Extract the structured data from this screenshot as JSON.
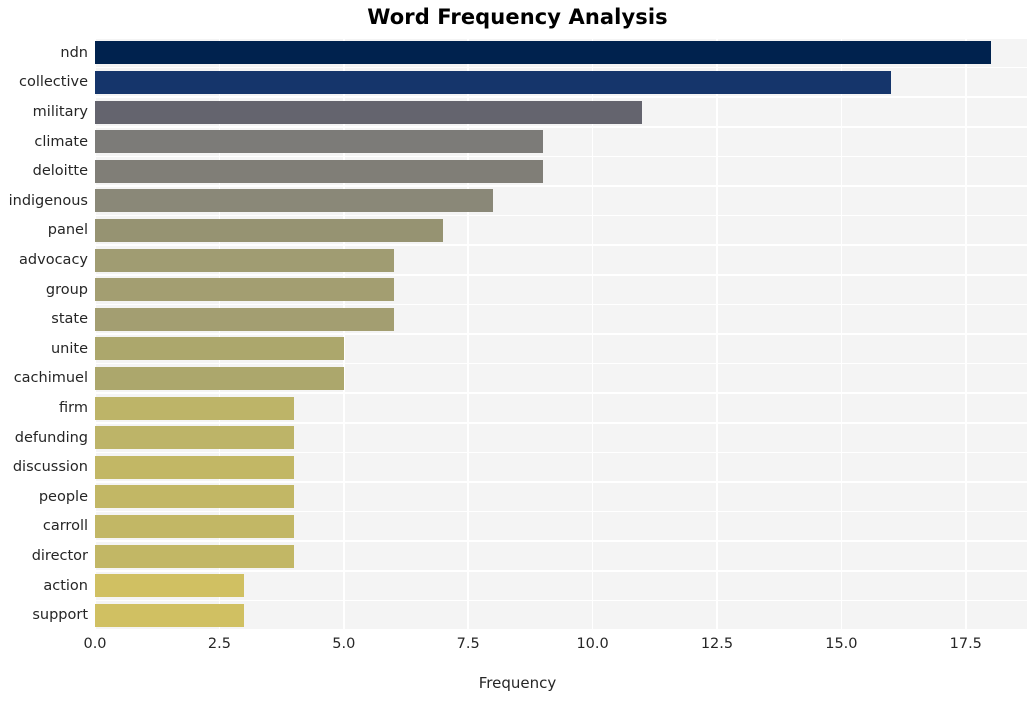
{
  "chart_data": {
    "type": "bar",
    "orientation": "horizontal",
    "title": "Word Frequency Analysis",
    "xlabel": "Frequency",
    "ylabel": "",
    "categories": [
      "ndn",
      "collective",
      "military",
      "climate",
      "deloitte",
      "indigenous",
      "panel",
      "advocacy",
      "group",
      "state",
      "unite",
      "cachimuel",
      "firm",
      "defunding",
      "discussion",
      "people",
      "carroll",
      "director",
      "action",
      "support"
    ],
    "values": [
      18,
      16,
      11,
      9,
      9,
      8,
      7,
      6,
      6,
      6,
      5,
      5,
      4,
      4,
      4,
      4,
      4,
      4,
      3,
      3
    ],
    "bar_colors": [
      "#00224e",
      "#15356b",
      "#64646e",
      "#7c7b78",
      "#807e77",
      "#8a8878",
      "#969372",
      "#a09c72",
      "#a39e71",
      "#a39e71",
      "#aca76c",
      "#aca76c",
      "#bdb468",
      "#bdb468",
      "#c2b765",
      "#c2b765",
      "#c2b765",
      "#c2b765",
      "#d0c062",
      "#d0c062"
    ],
    "xlim": [
      0,
      18.73
    ],
    "xticks": [
      "0.0",
      "2.5",
      "5.0",
      "7.5",
      "10.0",
      "12.5",
      "15.0",
      "17.5"
    ],
    "xtick_values": [
      0,
      2.5,
      5,
      7.5,
      10,
      12.5,
      15,
      17.5
    ],
    "grid": true,
    "legend": "none",
    "plot_background": "#f4f4f4",
    "gridline_color": "#ffffff",
    "figure_background": "#ffffff",
    "text_color": "#262626"
  }
}
